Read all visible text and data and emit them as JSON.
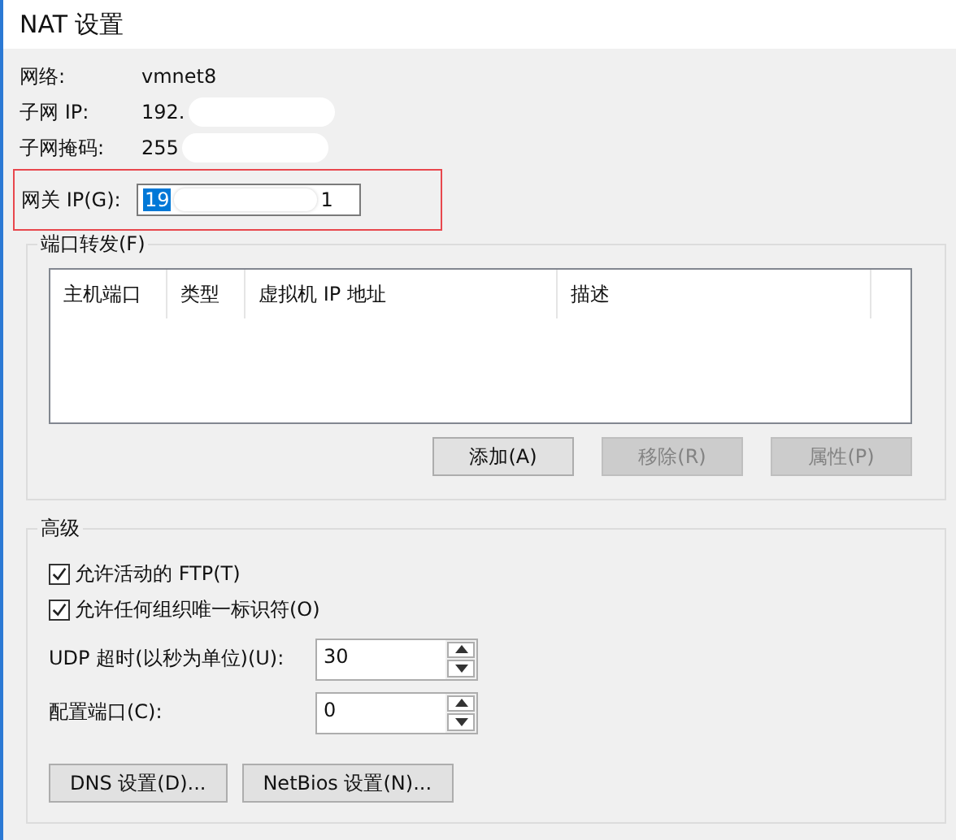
{
  "window": {
    "title": "NAT 设置"
  },
  "info": [
    {
      "label": "网络:",
      "value": "vmnet8"
    },
    {
      "label": "子网 IP:",
      "value": "192.",
      "redacted": true
    },
    {
      "label": "子网掩码:",
      "value": "255",
      "redacted": true
    }
  ],
  "gateway": {
    "label": "网关 IP(G):",
    "value_start": "19",
    "value_end": "1",
    "selected": true,
    "redacted": true,
    "highlighted": true
  },
  "port_forwarding": {
    "title": "端口转发(F)",
    "columns": [
      "主机端口",
      "类型",
      "虚拟机 IP 地址",
      "描述"
    ],
    "buttons": [
      {
        "label": "添加(A)",
        "disabled": false
      },
      {
        "label": "移除(R)",
        "disabled": true
      },
      {
        "label": "属性(P)",
        "disabled": true
      }
    ]
  },
  "advanced": {
    "title": "高级",
    "checkboxes": [
      {
        "label": "允许活动的 FTP(T)",
        "checked": true
      },
      {
        "label": "允许任何组织唯一标识符(O)",
        "checked": true
      }
    ],
    "spinners": [
      {
        "label": "UDP 超时(以秒为单位)(U):",
        "value": "30"
      },
      {
        "label": "配置端口(C):",
        "value": "0"
      }
    ],
    "buttons": [
      {
        "label": "DNS 设置(D)..."
      },
      {
        "label": "NetBios 设置(N)..."
      }
    ]
  }
}
